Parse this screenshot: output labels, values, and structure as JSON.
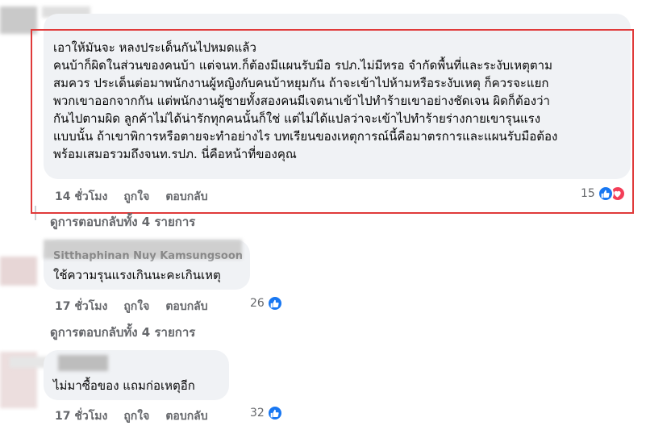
{
  "comments": [
    {
      "text": "เอาให้มันจะ หลงประเด็นกันไปหมดแล้ว\nคนบ้าก็ผิดในส่วนของคนบ้า แต่จนท.ก็ต้องมีแผนรับมือ รปภ.ไม่มีหรอ จำกัดพื้นที่และระงับเหตุตาม\nสมควร ประเด็นต่อมาพนักงานผู้หญิงกับคนบ้าหยุมกัน ถ้าจะเข้าไปห้ามหรือระงับเหตุ ก็ควรจะแยก\nพวกเขาออกจากกัน แต่พนักงานผู้ชายทั้งสองคนมีเจตนาเข้าไปทำร้ายเขาอย่างชัดเจน ผิดก็ต้องว่า\nกันไปตามผิด ลูกค้าไม่ได้น่ารักทุกคนนั้นก็ใช่ แต่ไม่ได้แปลว่าจะเข้าไปทำร้ายร่างกายเขารุนแรง\nแบบนั้น ถ้าเขาพิการหรือตายจะทำอย่างไร บทเรียนของเหตุการณ์นี้คือมาตรการและแผนรับมือต้อง\nพร้อมเสมอรวมถึงจนท.รปภ. นี่คือหน้าที่ของคุณ",
      "time": "14 ชั่วโมง",
      "like": "ถูกใจ",
      "reply": "ตอบกลับ",
      "reaction_count": "15",
      "reactions": [
        "like-icon",
        "love-icon"
      ]
    },
    {
      "author": "Sitthaphinan Nuy Kamsungsoon",
      "text": "ใช้ความรุนแรงเกินนะคะเกินเหตุ",
      "time": "17 ชั่วโมง",
      "like": "ถูกใจ",
      "reply": "ตอบกลับ",
      "reaction_count": "26",
      "reactions": [
        "like-icon"
      ]
    },
    {
      "text": "ไม่มาซื้อของ แถมก่อเหตุอีก",
      "time": "17 ชั่วโมง",
      "like": "ถูกใจ",
      "reply": "ตอบกลับ",
      "reaction_count": "32",
      "reactions": [
        "like-icon"
      ]
    }
  ],
  "view_replies": [
    "ดูการตอบกลับทั้ง 4 รายการ",
    "ดูการตอบกลับทั้ง 4 รายการ"
  ],
  "colors": {
    "bubble": "#f0f2f5",
    "meta": "#65676b",
    "like": "#1877f2",
    "love": "#f33e58",
    "highlight": "#e03a3a"
  }
}
